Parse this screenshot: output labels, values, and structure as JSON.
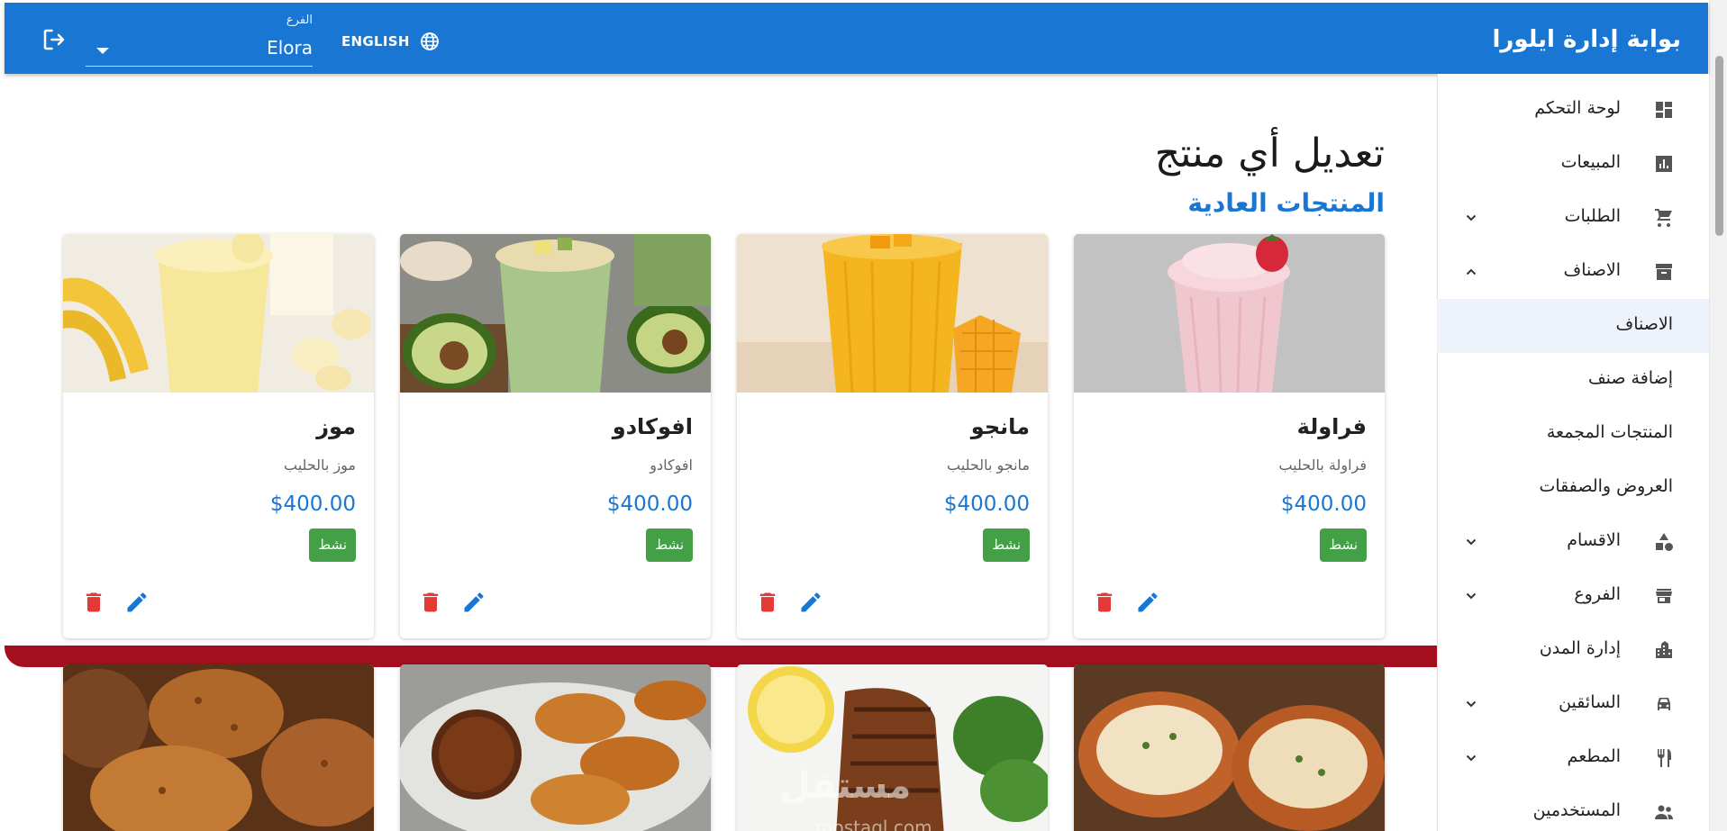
{
  "header": {
    "app_title": "بوابة إدارة ايلورا",
    "branch_label": "الفرع",
    "branch_value": "Elora",
    "language_label": "ENGLISH"
  },
  "sidebar": {
    "items": [
      {
        "label": "لوحة التحكم",
        "icon": "dashboard-icon"
      },
      {
        "label": "المبيعات",
        "icon": "bar-chart-icon"
      },
      {
        "label": "الطلبات",
        "icon": "cart-icon",
        "expandable": true
      },
      {
        "label": "الاصناف",
        "icon": "archive-icon",
        "expanded": true
      },
      {
        "label": "الاقسام",
        "icon": "category-shapes-icon",
        "expandable": true
      },
      {
        "label": "الفروع",
        "icon": "store-icon",
        "expandable": true
      },
      {
        "label": "إدارة المدن",
        "icon": "city-icon"
      },
      {
        "label": "السائقين",
        "icon": "car-icon",
        "expandable": true
      },
      {
        "label": "المطعم",
        "icon": "restaurant-icon",
        "expandable": true
      },
      {
        "label": "المستخدمين",
        "icon": "people-icon"
      }
    ],
    "sub_items": [
      {
        "label": "الاصناف",
        "active": true
      },
      {
        "label": "إضافة صنف"
      },
      {
        "label": "المنتجات المجمعة"
      },
      {
        "label": "العروض والصفقات"
      }
    ]
  },
  "main": {
    "page_title": "تعديل أي منتج",
    "section_title": "المنتجات العادية",
    "products": [
      {
        "name": "فراولة",
        "description": "فراولة بالحليب",
        "price": "$400.00",
        "status": "نشط",
        "image": "strawberry-milkshake"
      },
      {
        "name": "مانجو",
        "description": "مانجو بالحليب",
        "price": "$400.00",
        "status": "نشط",
        "image": "mango-smoothie"
      },
      {
        "name": "افوكادو",
        "description": "افوكادو",
        "price": "$400.00",
        "status": "نشط",
        "image": "avocado-smoothie"
      },
      {
        "name": "موز",
        "description": "موز بالحليب",
        "price": "$400.00",
        "status": "نشط",
        "image": "banana-smoothie"
      }
    ],
    "second_row_images": [
      "grilled-lobster",
      "grilled-fish",
      "fried-shrimp",
      "fried-chicken"
    ],
    "watermark": "مستقل",
    "watermark_sub": "mostaql.com"
  },
  "colors": {
    "primary": "#1976d2",
    "status_active": "#43a047",
    "delete": "#e53935",
    "separator": "#a50e1e",
    "active_sub_bg": "#edf2fb"
  }
}
